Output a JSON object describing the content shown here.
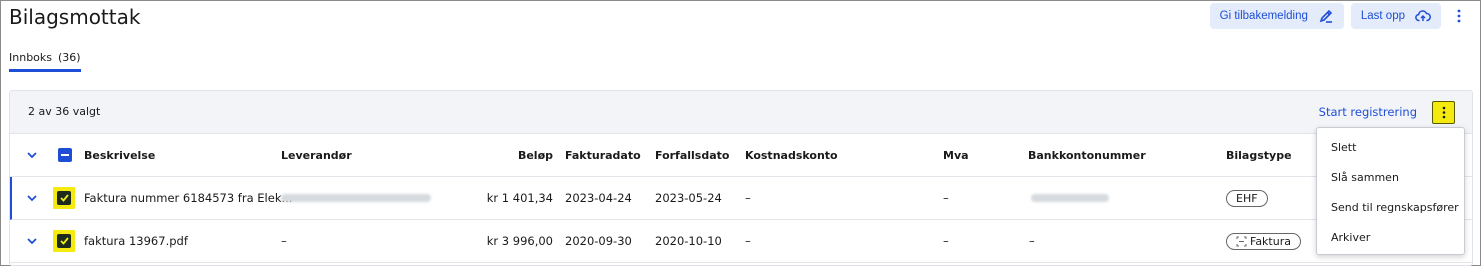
{
  "page": {
    "title": "Bilagsmottak"
  },
  "actions": {
    "feedback_label": "Gi tilbakemelding",
    "upload_label": "Last opp"
  },
  "tab": {
    "label": "Innboks",
    "count": "(36)"
  },
  "selection": {
    "summary": "2 av 36 valgt",
    "start_label": "Start registrering"
  },
  "columns": {
    "description": "Beskrivelse",
    "supplier": "Leverandør",
    "amount": "Beløp",
    "invoice_date": "Fakturadato",
    "due_date": "Forfallsdato",
    "cost_account": "Kostnadskonto",
    "vat": "Mva",
    "bank_account": "Bankkontonummer",
    "doc_type": "Bilagstype"
  },
  "rows": [
    {
      "description": "Faktura nummer 6184573 fra Elek...",
      "supplier": "",
      "amount": "kr 1 401,34",
      "invoice_date": "2023-04-24",
      "due_date": "2023-05-24",
      "cost_account": "–",
      "vat": "–",
      "bank_account": "",
      "doc_type": "EHF"
    },
    {
      "description": "faktura 13967.pdf",
      "supplier": "–",
      "amount": "kr 3 996,00",
      "invoice_date": "2020-09-30",
      "due_date": "2020-10-10",
      "cost_account": "–",
      "vat": "–",
      "bank_account": "–",
      "doc_type": "Faktura"
    }
  ],
  "menu": {
    "items": [
      "Slett",
      "Slå sammen",
      "Send til regnskapsfører",
      "Arkiver"
    ]
  },
  "colors": {
    "accent": "#1e4ed6",
    "highlight": "#f5ea10",
    "soft_button": "#e4ecfb"
  }
}
